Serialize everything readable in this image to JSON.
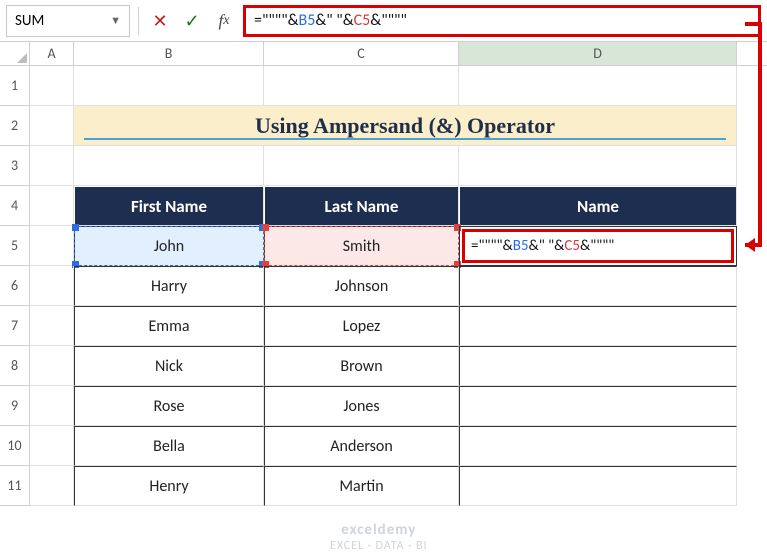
{
  "namebox": {
    "value": "SUM"
  },
  "formula_bar": {
    "text_raw": "=\"\"\"\"&B5&\" \"&C5&\"\"\"\"",
    "seg1": "=\"\"\"\"&",
    "refB": "B5",
    "seg2": "&\" \"&",
    "refC": "C5",
    "seg3": "&\"\"\"\""
  },
  "columns": [
    "A",
    "B",
    "C",
    "D"
  ],
  "rows": [
    "1",
    "2",
    "3",
    "4",
    "5",
    "6",
    "7",
    "8",
    "9",
    "10",
    "11"
  ],
  "title": "Using Ampersand (&) Operator",
  "headers": {
    "b": "First Name",
    "c": "Last Name",
    "d": "Name"
  },
  "data": [
    {
      "first": "John",
      "last": "Smith"
    },
    {
      "first": "Harry",
      "last": "Johnson"
    },
    {
      "first": "Emma",
      "last": "Lopez"
    },
    {
      "first": "Nick",
      "last": "Brown"
    },
    {
      "first": "Rose",
      "last": "Jones"
    },
    {
      "first": "Bella",
      "last": "Anderson"
    },
    {
      "first": "Henry",
      "last": "Martin"
    }
  ],
  "watermark": {
    "line1": "exceldemy",
    "line2": "EXCEL · DATA · BI"
  }
}
